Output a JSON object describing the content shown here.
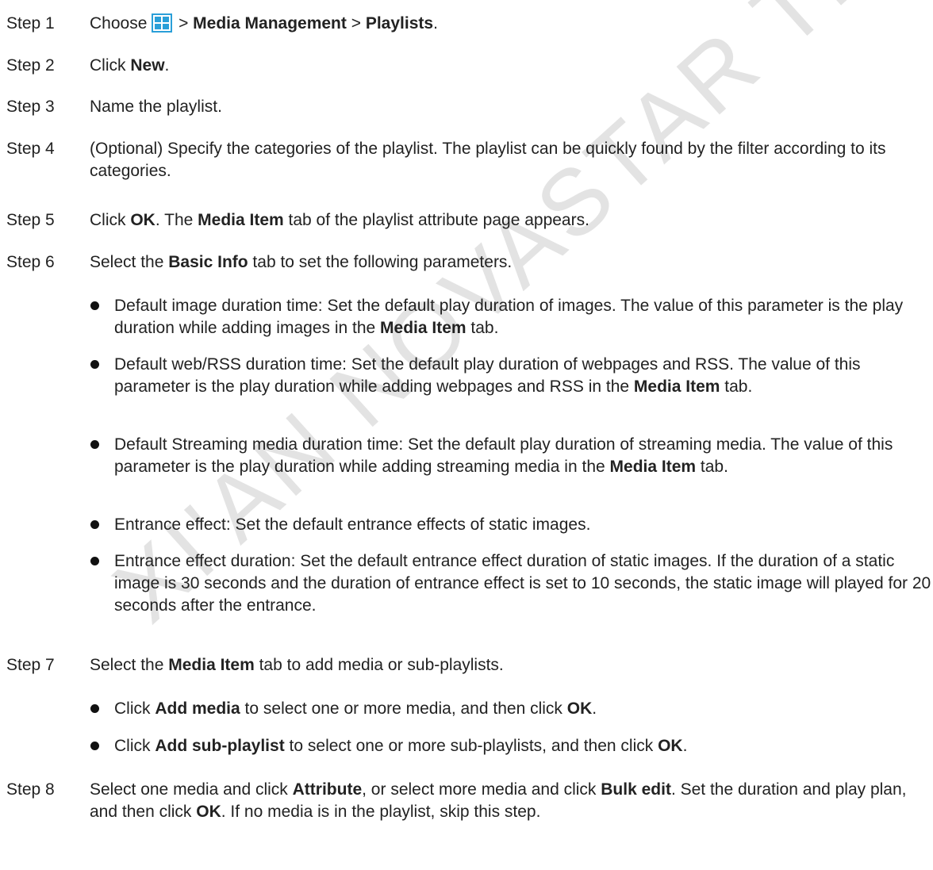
{
  "watermark": {
    "text": "XI'AN NOVASTAR TECH",
    "color": "#e3e3e3"
  },
  "icons": {
    "menu": {
      "name": "grid-menu-icon",
      "color": "#2a9fd8"
    }
  },
  "steps": [
    {
      "label": "Step 1",
      "t1": "Choose",
      "t2": " > ",
      "b1": "Media Management",
      "t3": " > ",
      "b2": "Playlists",
      "t4": "."
    },
    {
      "label": "Step 2",
      "t1": "Click ",
      "b1": "New",
      "t2": "."
    },
    {
      "label": "Step 3",
      "t1": "Name the playlist."
    },
    {
      "label": "Step 4",
      "t1": "(Optional) Specify the categories of the playlist. The playlist can be quickly found by the filter according to its categories."
    },
    {
      "label": "Step 5",
      "t1": "Click ",
      "b1": "OK",
      "t2": ". The ",
      "b2": "Media Item",
      "t3": " tab of the playlist attribute page appears."
    },
    {
      "label": "Step 6",
      "t1": "Select the ",
      "b1": "Basic Info",
      "t2": " tab to set the following parameters.",
      "bullets": [
        {
          "t1": "Default image duration time: Set the default play duration of images. The value of this parameter is the play duration while adding images in the ",
          "b1": "Media Item",
          "t2": " tab."
        },
        {
          "t1": "Default web/RSS duration time: Set the default play duration of webpages and RSS. The value of this parameter is the play duration while adding webpages and RSS in the ",
          "b1": "Media Item",
          "t2": " tab."
        },
        {
          "t1": "Default Streaming media duration time: Set the default play duration of streaming media. The value of this parameter is the play duration while adding streaming media in the ",
          "b1": "Media Item",
          "t2": " tab."
        },
        {
          "t1": "Entrance effect: Set the default entrance effects of static images."
        },
        {
          "t1": "Entrance effect duration: Set the default entrance effect duration of static images. If the duration of a static image is 30 seconds and the duration of entrance effect is set to 10 seconds, the static image will played for 20 seconds after the entrance."
        }
      ]
    },
    {
      "label": "Step 7",
      "t1": "Select the ",
      "b1": "Media Item",
      "t2": " tab to add media or sub-playlists.",
      "bullets": [
        {
          "t1": "Click ",
          "b1": "Add media",
          "t2": " to select one or more media, and then click ",
          "b2": "OK",
          "t3": "."
        },
        {
          "t1": "Click ",
          "b1": "Add sub-playlist",
          "t2": " to select one or more sub-playlists, and then click ",
          "b2": "OK",
          "t3": "."
        }
      ]
    },
    {
      "label": "Step 8",
      "t1": "Select one media and click ",
      "b1": "Attribute",
      "t2": ", or select more media and click ",
      "b2": "Bulk edit",
      "t3": ". Set the duration and play plan, and then click ",
      "b3": "OK",
      "t4": ". If no media is in the playlist, skip this step."
    }
  ]
}
